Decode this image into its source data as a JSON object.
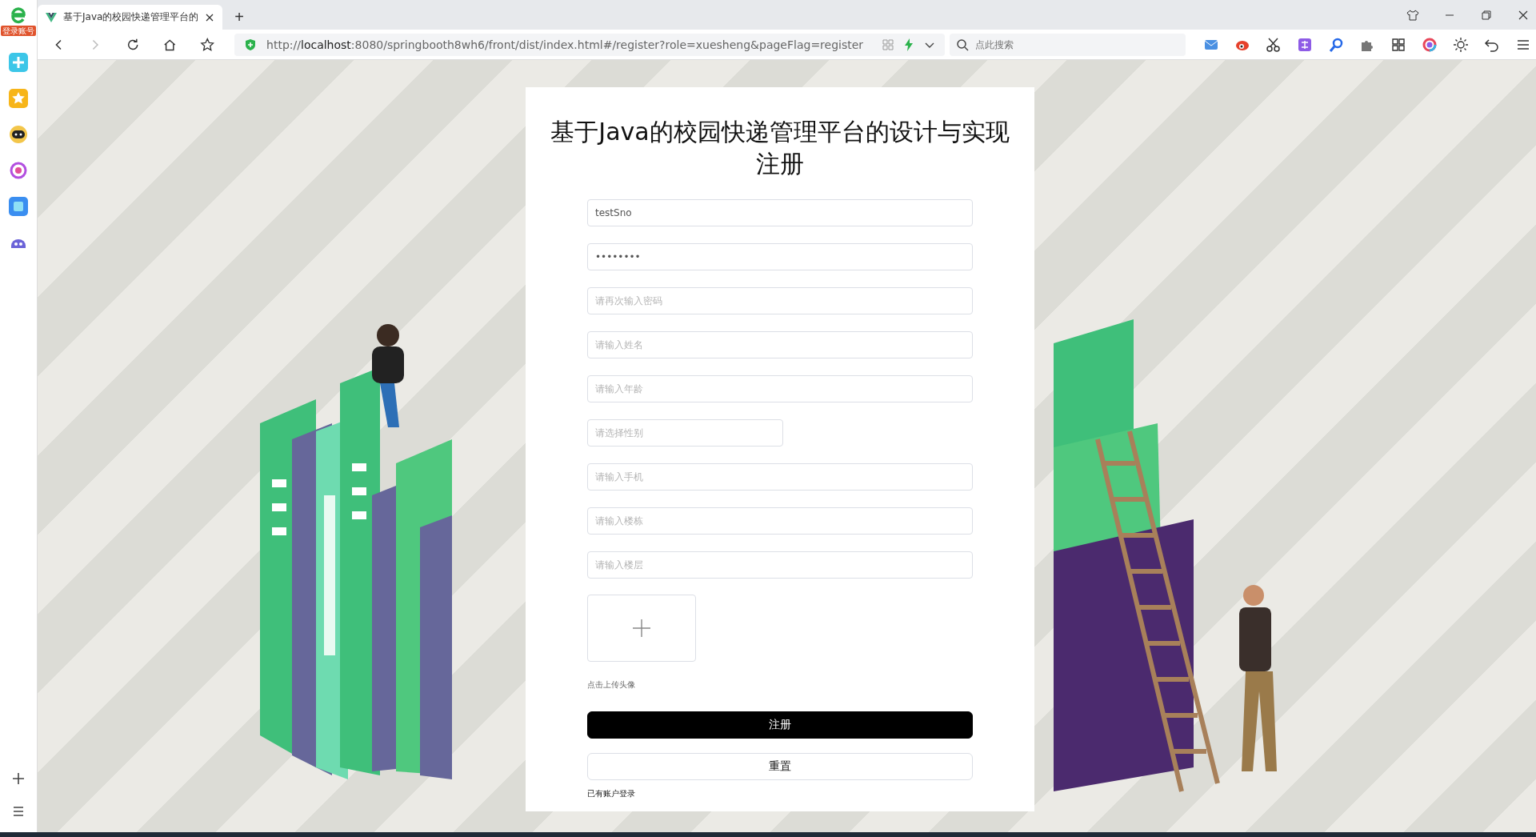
{
  "browser": {
    "account_badge": "登录账号",
    "tab_title": "基于Java的校园快递管理平台的",
    "new_tab": "+",
    "url": "http://**localhost**:8080/springbooth8wh6/front/dist/index.html#/register?role=xuesheng&pageFlag=register",
    "search_placeholder": "点此搜索"
  },
  "form": {
    "title": "基于Java的校园快递管理平台的设计与实现",
    "subtitle": "注册",
    "fields": [
      {
        "kind": "input",
        "value": "testSno"
      },
      {
        "kind": "input",
        "value": "••••••••"
      },
      {
        "kind": "input",
        "placeholder": "请再次输入密码"
      },
      {
        "kind": "input",
        "placeholder": "请输入姓名"
      },
      {
        "kind": "input",
        "placeholder": "请输入年龄"
      },
      {
        "kind": "select",
        "placeholder": "请选择性别"
      },
      {
        "kind": "input",
        "placeholder": "请输入手机"
      },
      {
        "kind": "input",
        "placeholder": "请输入楼栋"
      },
      {
        "kind": "input",
        "placeholder": "请输入楼层"
      }
    ],
    "upload_hint": "点击上传头像",
    "register_button": "注册",
    "reset_button": "重置",
    "login_link": "已有账户登录"
  }
}
